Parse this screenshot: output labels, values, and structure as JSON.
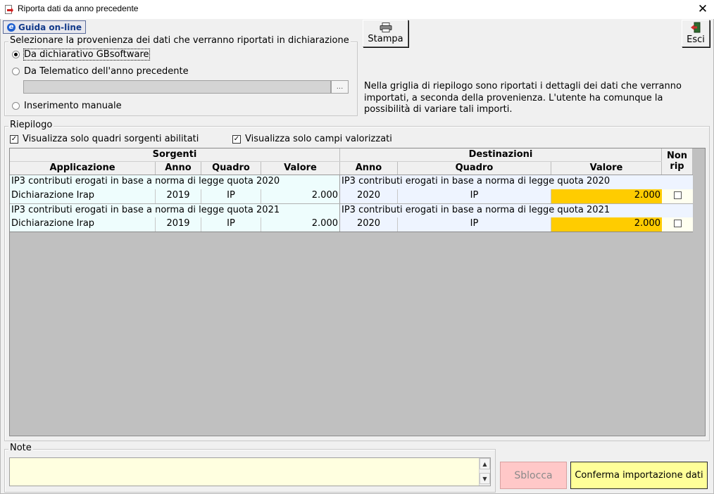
{
  "window": {
    "title": "Riporta dati da anno precedente",
    "close_label": "✕"
  },
  "toolbar": {
    "guida_label": "Guida on-line",
    "stampa_label": "Stampa",
    "esci_label": "Esci"
  },
  "provenance": {
    "legend": "Selezionare la provenienza dei dati che verranno riportati in dichiarazione",
    "options": [
      {
        "label": "Da dichiarativo GBsoftware",
        "selected": true
      },
      {
        "label": "Da Telematico dell'anno precedente",
        "selected": false
      },
      {
        "label": "Inserimento manuale",
        "selected": false
      }
    ],
    "file_button": "..."
  },
  "info": {
    "text": "Nella griglia di riepilogo sono riportati i dettagli dei dati che verranno importati, a seconda della provenienza. L'utente ha comunque la possibilità di variare tali importi."
  },
  "riepilogo": {
    "legend": "Riepilogo",
    "check_sorgenti": "Visualizza solo quadri sorgenti abilitati",
    "check_campi": "Visualizza solo campi valorizzati",
    "check_mark": "✓"
  },
  "grid": {
    "group_sorgenti": "Sorgenti",
    "group_destinazioni": "Destinazioni",
    "col_applicazione": "Applicazione",
    "col_anno": "Anno",
    "col_quadro": "Quadro",
    "col_valore": "Valore",
    "col_nonrip_1": "Non",
    "col_nonrip_2": "rip",
    "rows": [
      {
        "src_desc": "IP3 contributi erogati in base a norma di legge quota 2020",
        "dst_desc": "IP3 contributi erogati in base a norma di legge quota 2020",
        "applicazione": "Dichiarazione Irap",
        "src_anno": "2019",
        "src_quadro": "IP",
        "src_valore": "2.000",
        "dst_anno": "2020",
        "dst_quadro": "IP",
        "dst_valore": "2.000"
      },
      {
        "src_desc": "IP3 contributi erogati in base a norma di legge quota 2021",
        "dst_desc": "IP3 contributi erogati in base a norma di legge quota 2021",
        "applicazione": "Dichiarazione Irap",
        "src_anno": "2019",
        "src_quadro": "IP",
        "src_valore": "2.000",
        "dst_anno": "2020",
        "dst_quadro": "IP",
        "dst_valore": "2.000"
      }
    ]
  },
  "note": {
    "legend": "Note",
    "value": ""
  },
  "footer": {
    "sblocca_label": "Sblocca",
    "conferma_label": "Conferma importazione dati"
  }
}
